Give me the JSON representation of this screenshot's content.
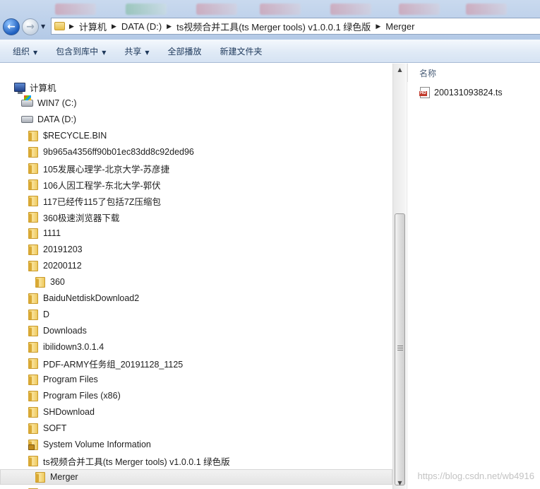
{
  "window": {
    "path": [
      "计算机",
      "DATA (D:)",
      "ts视频合并工具(ts Merger tools) v1.0.0.1 绿色版",
      "Merger"
    ]
  },
  "toolbar": {
    "organize": "组织",
    "include_in_library": "包含到库中",
    "share": "共享",
    "play_all": "全部播放",
    "new_folder": "新建文件夹"
  },
  "tree": {
    "computer": "计算机",
    "drives": [
      {
        "label": "WIN7 (C:)"
      },
      {
        "label": "DATA (D:)"
      }
    ],
    "folders": [
      "$RECYCLE.BIN",
      "9b965a4356ff90b01ec83dd8c92ded96",
      "105发展心理学-北京大学-苏彦捷",
      "106人因工程学-东北大学-郭伏",
      "117已经传115了包括7Z压缩包",
      "360极速浏览器下载",
      "1111",
      "20191203",
      "20200112",
      "360",
      "BaiduNetdiskDownload2",
      "D",
      "Downloads",
      "ibilidown3.0.1.4",
      "PDF-ARMY任务组_20191128_1125",
      "Program Files",
      "Program Files (x86)",
      "SHDownload",
      "SOFT",
      "System Volume Information",
      "ts视频合并工具(ts Merger tools) v1.0.0.1 绿色版",
      "Merger"
    ],
    "selected": "Merger"
  },
  "file_list": {
    "column_name": "名称",
    "files": [
      "200131093824.ts"
    ]
  },
  "watermark": "https://blog.csdn.net/wb4916"
}
